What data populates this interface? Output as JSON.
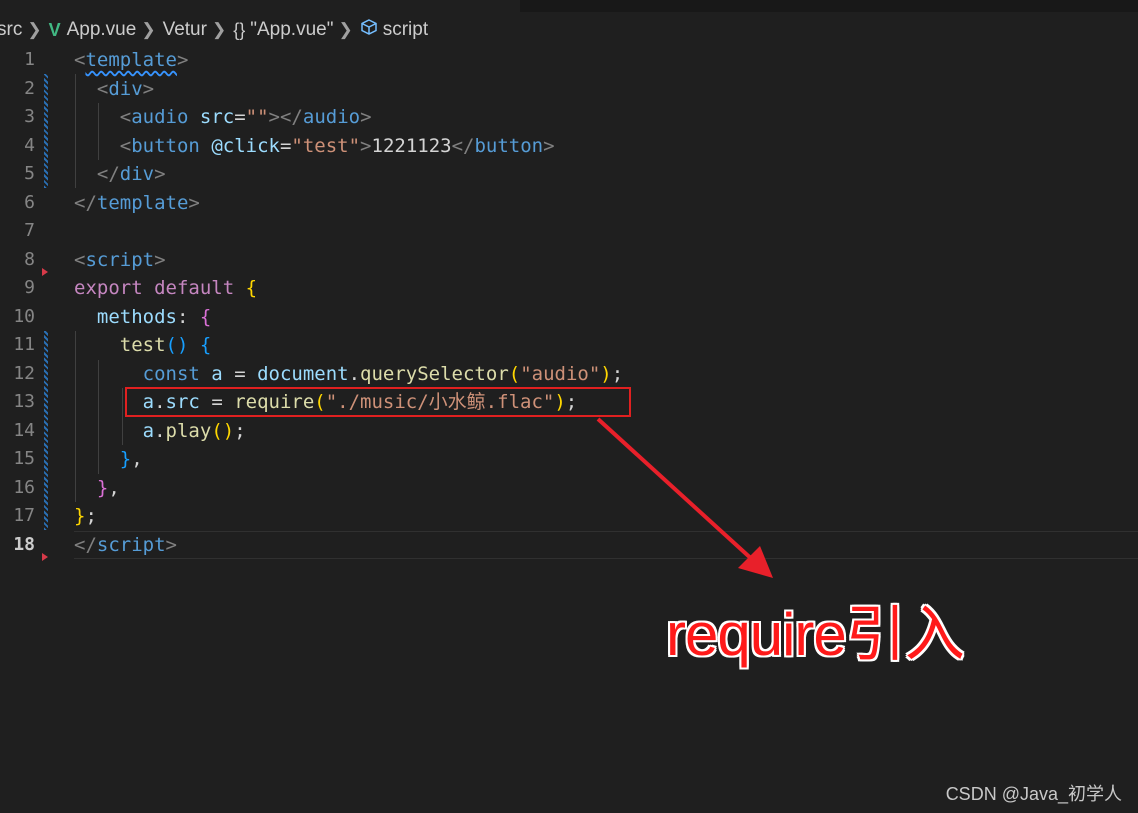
{
  "breadcrumb": {
    "folder": "src",
    "file": "App.vue",
    "language_server": "Vetur",
    "object": "\"App.vue\"",
    "brace_glyph": "{}",
    "symbol": "script"
  },
  "lines": [
    {
      "n": "1",
      "segs": [
        {
          "c": "tag-bracket",
          "t": "<"
        },
        {
          "c": "tag squiggle",
          "t": "template"
        },
        {
          "c": "tag-bracket",
          "t": ">"
        }
      ]
    },
    {
      "n": "2",
      "segs": [
        {
          "c": "",
          "t": "  "
        },
        {
          "c": "tag-bracket",
          "t": "<"
        },
        {
          "c": "tag",
          "t": "div"
        },
        {
          "c": "tag-bracket",
          "t": ">"
        }
      ]
    },
    {
      "n": "3",
      "segs": [
        {
          "c": "",
          "t": "    "
        },
        {
          "c": "tag-bracket",
          "t": "<"
        },
        {
          "c": "tag",
          "t": "audio"
        },
        {
          "c": "",
          "t": " "
        },
        {
          "c": "attr",
          "t": "src"
        },
        {
          "c": "txt",
          "t": "="
        },
        {
          "c": "str",
          "t": "\"\""
        },
        {
          "c": "tag-bracket",
          "t": "></"
        },
        {
          "c": "tag",
          "t": "audio"
        },
        {
          "c": "tag-bracket",
          "t": ">"
        }
      ]
    },
    {
      "n": "4",
      "segs": [
        {
          "c": "",
          "t": "    "
        },
        {
          "c": "tag-bracket",
          "t": "<"
        },
        {
          "c": "tag",
          "t": "button"
        },
        {
          "c": "",
          "t": " "
        },
        {
          "c": "attr",
          "t": "@click"
        },
        {
          "c": "txt",
          "t": "="
        },
        {
          "c": "str",
          "t": "\"test\""
        },
        {
          "c": "tag-bracket",
          "t": ">"
        },
        {
          "c": "txt",
          "t": "1221123"
        },
        {
          "c": "tag-bracket",
          "t": "</"
        },
        {
          "c": "tag",
          "t": "button"
        },
        {
          "c": "tag-bracket",
          "t": ">"
        }
      ]
    },
    {
      "n": "5",
      "segs": [
        {
          "c": "",
          "t": "  "
        },
        {
          "c": "tag-bracket",
          "t": "</"
        },
        {
          "c": "tag",
          "t": "div"
        },
        {
          "c": "tag-bracket",
          "t": ">"
        }
      ]
    },
    {
      "n": "6",
      "segs": [
        {
          "c": "tag-bracket",
          "t": "</"
        },
        {
          "c": "tag",
          "t": "template"
        },
        {
          "c": "tag-bracket",
          "t": ">"
        }
      ]
    },
    {
      "n": "7",
      "segs": []
    },
    {
      "n": "8",
      "segs": [
        {
          "c": "tag-bracket",
          "t": "<"
        },
        {
          "c": "tag",
          "t": "script"
        },
        {
          "c": "tag-bracket",
          "t": ">"
        }
      ]
    },
    {
      "n": "9",
      "segs": [
        {
          "c": "kw",
          "t": "export"
        },
        {
          "c": "",
          "t": " "
        },
        {
          "c": "kw",
          "t": "default"
        },
        {
          "c": "",
          "t": " "
        },
        {
          "c": "y",
          "t": "{"
        }
      ]
    },
    {
      "n": "10",
      "segs": [
        {
          "c": "",
          "t": "  "
        },
        {
          "c": "var",
          "t": "methods"
        },
        {
          "c": "txt",
          "t": ": "
        },
        {
          "c": "p",
          "t": "{"
        }
      ]
    },
    {
      "n": "11",
      "segs": [
        {
          "c": "",
          "t": "    "
        },
        {
          "c": "fn",
          "t": "test"
        },
        {
          "c": "b",
          "t": "()"
        },
        {
          "c": "",
          "t": " "
        },
        {
          "c": "b",
          "t": "{"
        }
      ]
    },
    {
      "n": "12",
      "segs": [
        {
          "c": "",
          "t": "      "
        },
        {
          "c": "st",
          "t": "const"
        },
        {
          "c": "",
          "t": " "
        },
        {
          "c": "var",
          "t": "a"
        },
        {
          "c": "txt",
          "t": " = "
        },
        {
          "c": "var",
          "t": "document"
        },
        {
          "c": "txt",
          "t": "."
        },
        {
          "c": "fn",
          "t": "querySelector"
        },
        {
          "c": "y",
          "t": "("
        },
        {
          "c": "str",
          "t": "\"audio\""
        },
        {
          "c": "y",
          "t": ")"
        },
        {
          "c": "txt",
          "t": ";"
        }
      ]
    },
    {
      "n": "13",
      "segs": [
        {
          "c": "",
          "t": "      "
        },
        {
          "c": "var",
          "t": "a"
        },
        {
          "c": "txt",
          "t": "."
        },
        {
          "c": "var",
          "t": "src"
        },
        {
          "c": "txt",
          "t": " = "
        },
        {
          "c": "fn",
          "t": "require"
        },
        {
          "c": "y",
          "t": "("
        },
        {
          "c": "str",
          "t": "\"./music/小水鲸.flac\""
        },
        {
          "c": "y",
          "t": ")"
        },
        {
          "c": "txt",
          "t": ";"
        }
      ]
    },
    {
      "n": "14",
      "segs": [
        {
          "c": "",
          "t": "      "
        },
        {
          "c": "var",
          "t": "a"
        },
        {
          "c": "txt",
          "t": "."
        },
        {
          "c": "fn",
          "t": "play"
        },
        {
          "c": "y",
          "t": "()"
        },
        {
          "c": "txt",
          "t": ";"
        }
      ]
    },
    {
      "n": "15",
      "segs": [
        {
          "c": "",
          "t": "    "
        },
        {
          "c": "b",
          "t": "}"
        },
        {
          "c": "txt",
          "t": ","
        }
      ]
    },
    {
      "n": "16",
      "segs": [
        {
          "c": "",
          "t": "  "
        },
        {
          "c": "p",
          "t": "}"
        },
        {
          "c": "txt",
          "t": ","
        }
      ]
    },
    {
      "n": "17",
      "segs": [
        {
          "c": "y",
          "t": "}"
        },
        {
          "c": "txt",
          "t": ";"
        }
      ]
    },
    {
      "n": "18",
      "segs": [
        {
          "c": "tag-bracket",
          "t": "</"
        },
        {
          "c": "tag",
          "t": "script"
        },
        {
          "c": "tag-bracket",
          "t": ">"
        }
      ]
    }
  ],
  "active_line": "18",
  "annotation_text": "require引入",
  "watermark": "CSDN @Java_初学人",
  "colors": {
    "annotation": "#ff1a1a",
    "highlight_box": "#e02020",
    "arrow": "#e8202a"
  }
}
